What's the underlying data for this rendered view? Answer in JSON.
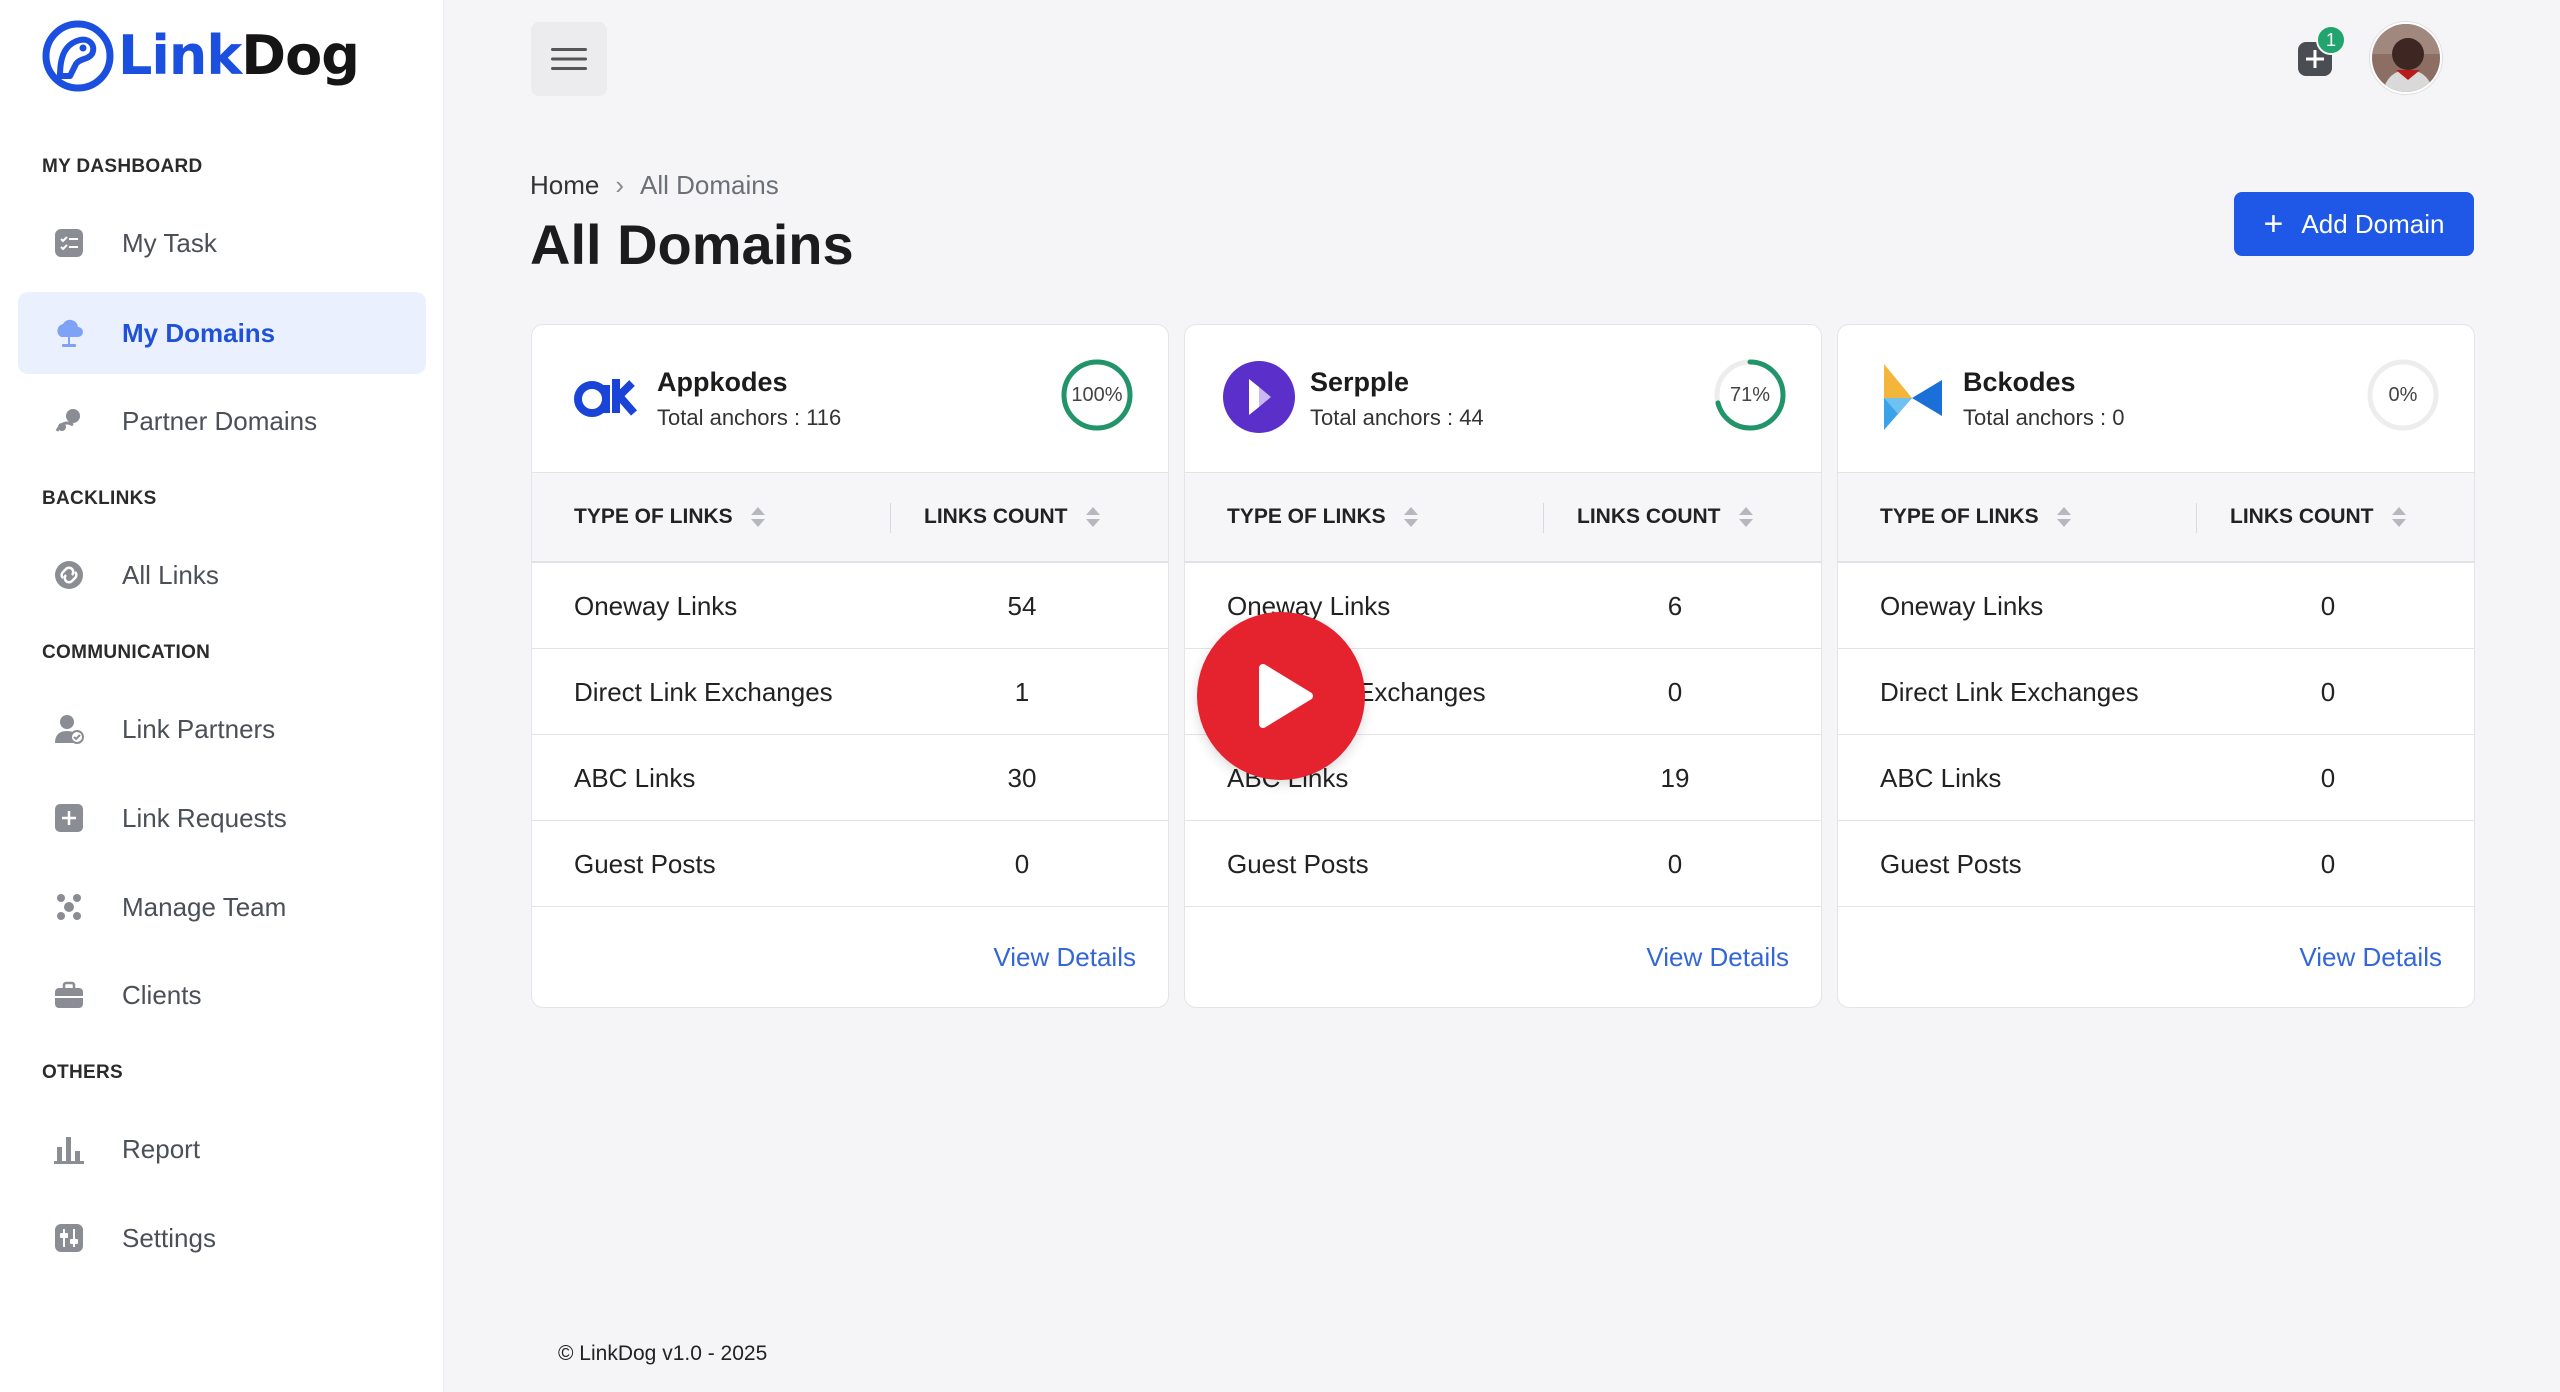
{
  "brand": {
    "link": "Link",
    "dog": "Dog"
  },
  "sidebar": {
    "sections": [
      {
        "title": "MY DASHBOARD"
      },
      {
        "title": "BACKLINKS"
      },
      {
        "title": "COMMUNICATION"
      },
      {
        "title": "OTHERS"
      }
    ],
    "items": [
      {
        "label": "My Task",
        "icon": "task-list-icon"
      },
      {
        "label": "My Domains",
        "icon": "cloud-icon",
        "active": true
      },
      {
        "label": "Partner Domains",
        "icon": "partner-icon"
      },
      {
        "label": "All Links",
        "icon": "link-icon"
      },
      {
        "label": "Link Partners",
        "icon": "user-check-icon"
      },
      {
        "label": "Link Requests",
        "icon": "plus-square-icon"
      },
      {
        "label": "Manage Team",
        "icon": "team-icon"
      },
      {
        "label": "Clients",
        "icon": "briefcase-icon"
      },
      {
        "label": "Report",
        "icon": "bar-chart-icon"
      },
      {
        "label": "Settings",
        "icon": "settings-icon"
      }
    ]
  },
  "topbar": {
    "notification_count": "1"
  },
  "header": {
    "breadcrumb_home": "Home",
    "breadcrumb_sep": "›",
    "breadcrumb_current": "All Domains",
    "title": "All Domains",
    "add_button_icon": "+",
    "add_button": "Add Domain"
  },
  "table_headers": {
    "type": "TYPE OF LINKS",
    "count": "LINKS COUNT"
  },
  "cards": [
    {
      "name": "Appkodes",
      "anchors": "Total anchors : 116",
      "progress_label": "100%",
      "progress": 1.0,
      "rows": [
        {
          "type": "Oneway Links",
          "count": "54"
        },
        {
          "type": "Direct Link Exchanges",
          "count": "1"
        },
        {
          "type": "ABC Links",
          "count": "30"
        },
        {
          "type": "Guest Posts",
          "count": "0"
        }
      ],
      "view": "View Details"
    },
    {
      "name": "Serpple",
      "anchors": "Total anchors : 44",
      "progress_label": "71%",
      "progress": 0.71,
      "rows": [
        {
          "type": "Oneway Links",
          "count": "6"
        },
        {
          "type": "Direct Link Exchanges",
          "count": "0"
        },
        {
          "type": "ABC Links",
          "count": "19"
        },
        {
          "type": "Guest Posts",
          "count": "0"
        }
      ],
      "view": "View Details"
    },
    {
      "name": "Bckodes",
      "anchors": "Total anchors : 0",
      "progress_label": "0%",
      "progress": 0,
      "rows": [
        {
          "type": "Oneway Links",
          "count": "0"
        },
        {
          "type": "Direct Link Exchanges",
          "count": "0"
        },
        {
          "type": "ABC Links",
          "count": "0"
        },
        {
          "type": "Guest Posts",
          "count": "0"
        }
      ],
      "view": "View Details"
    }
  ],
  "colors": {
    "accent": "#1f57e6",
    "progress": "#21946a",
    "play": "#e5232e"
  },
  "footer": "© LinkDog v1.0 - 2025"
}
